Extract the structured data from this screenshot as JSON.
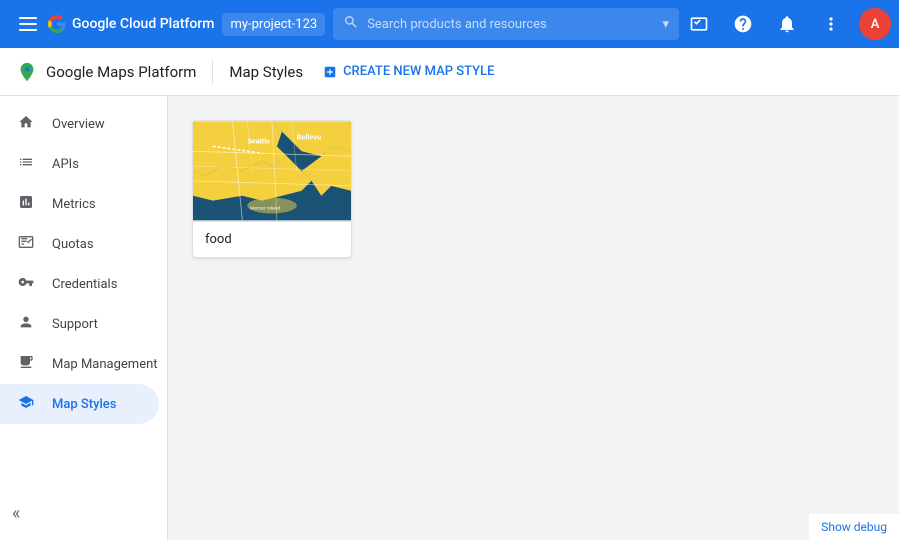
{
  "topbar": {
    "menu_icon": "☰",
    "logo_text": "Google Cloud Platform",
    "project_name": "my-project-123",
    "search_placeholder": "Search products and resources",
    "actions": {
      "cloud_shell_icon": "⚡",
      "help_icon": "?",
      "bell_icon": "🔔",
      "more_icon": "⋮",
      "avatar_text": "A"
    }
  },
  "subheader": {
    "app_title": "Google Maps Platform",
    "page_title": "Map Styles",
    "create_button_label": "CREATE NEW MAP STYLE"
  },
  "sidebar": {
    "items": [
      {
        "id": "overview",
        "label": "Overview",
        "icon": "home"
      },
      {
        "id": "apis",
        "label": "APIs",
        "icon": "list"
      },
      {
        "id": "metrics",
        "label": "Metrics",
        "icon": "bar_chart"
      },
      {
        "id": "quotas",
        "label": "Quotas",
        "icon": "monitor"
      },
      {
        "id": "credentials",
        "label": "Credentials",
        "icon": "key"
      },
      {
        "id": "support",
        "label": "Support",
        "icon": "person"
      },
      {
        "id": "map-management",
        "label": "Map Management",
        "icon": "layers"
      },
      {
        "id": "map-styles",
        "label": "Map Styles",
        "icon": "style",
        "active": true
      }
    ],
    "collapse_icon": "«"
  },
  "main": {
    "map_styles": [
      {
        "id": "food",
        "label": "food",
        "thumbnail_type": "seattle_map"
      }
    ]
  },
  "debug_bar": {
    "label": "Show debug"
  }
}
